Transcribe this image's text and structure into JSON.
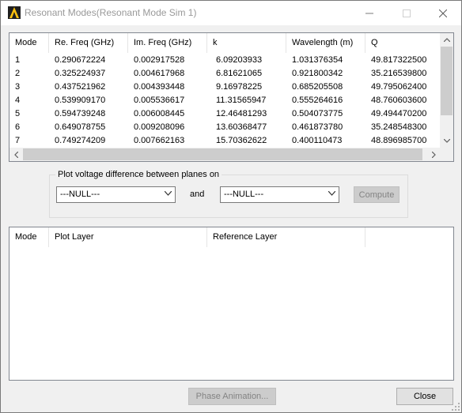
{
  "window": {
    "title": "Resonant Modes(Resonant Mode Sim 1)",
    "icons": [
      "app-logo-icon",
      "minimize-icon",
      "maximize-icon",
      "close-icon"
    ]
  },
  "modes_table": {
    "columns": [
      "Mode",
      "Re. Freq (GHz)",
      "Im. Freq (GHz)",
      "k",
      "Wavelength (m)",
      "Q"
    ],
    "rows": [
      [
        "1",
        "0.290672224",
        "0.002917528",
        "6.09203933",
        "1.031376354",
        "49.817322500"
      ],
      [
        "2",
        "0.325224937",
        "0.004617968",
        "6.81621065",
        "0.921800342",
        "35.216539800"
      ],
      [
        "3",
        "0.437521962",
        "0.004393448",
        "9.16978225",
        "0.685205508",
        "49.795062400"
      ],
      [
        "4",
        "0.539909170",
        "0.005536617",
        "11.31565947",
        "0.555264616",
        "48.760603600"
      ],
      [
        "5",
        "0.594739248",
        "0.006008445",
        "12.46481293",
        "0.504073775",
        "49.494470200"
      ],
      [
        "6",
        "0.649078755",
        "0.009208096",
        "13.60368477",
        "0.461873780",
        "35.248548300"
      ],
      [
        "7",
        "0.749274209",
        "0.007662163",
        "15.70362622",
        "0.400110473",
        "48.896985700"
      ]
    ]
  },
  "plot_group": {
    "label": "Plot voltage difference between planes on",
    "combo1_value": "---NULL---",
    "and_label": "and",
    "combo2_value": "---NULL---",
    "compute_label": "Compute"
  },
  "layers_table": {
    "columns": [
      "Mode",
      "Plot Layer",
      "Reference Layer"
    ]
  },
  "footer": {
    "phase_animation_label": "Phase Animation...",
    "close_label": "Close"
  }
}
